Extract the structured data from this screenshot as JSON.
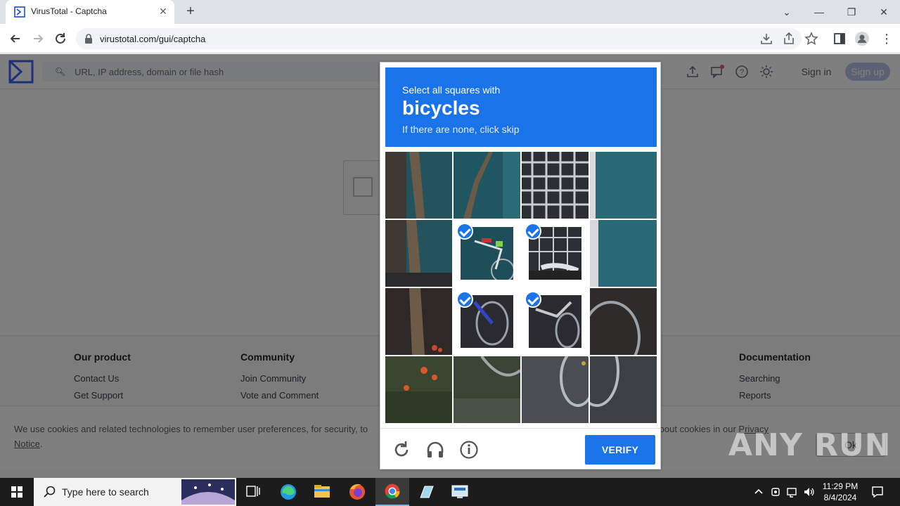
{
  "browser": {
    "tab_title": "VirusTotal - Captcha",
    "url": "virustotal.com/gui/captcha"
  },
  "vt": {
    "search_placeholder": "URL, IP address, domain or file hash",
    "signin": "Sign in",
    "signup": "Sign up"
  },
  "footer": {
    "columns": [
      {
        "heading": "Our product",
        "links": [
          "Contact Us",
          "Get Support"
        ]
      },
      {
        "heading": "Community",
        "links": [
          "Join Community",
          "Vote and Comment"
        ]
      },
      {
        "heading": "Documentation",
        "links": [
          "Searching",
          "Reports"
        ]
      }
    ]
  },
  "cookie": {
    "text_a": "We use cookies and related technologies to remember user preferences, for security, to",
    "text_b": "about cookies in our",
    "link_privacy": "Privacy",
    "link_notice": "Notice",
    "ok": "Ok"
  },
  "captcha": {
    "line1": "Select all squares with",
    "keyword": "bicycles",
    "line3": "If there are none, click skip",
    "verify": "VERIFY",
    "selected_tiles": [
      5,
      6,
      9,
      10
    ],
    "icons": [
      "reload-icon",
      "audio-icon",
      "info-icon"
    ]
  },
  "watermark": "ANY RUN",
  "taskbar": {
    "search_text": "Type here to search",
    "time": "11:29 PM",
    "date": "8/4/2024"
  },
  "colors": {
    "captcha_blue": "#1a73e8",
    "taskbar": "#1c1c1c"
  }
}
